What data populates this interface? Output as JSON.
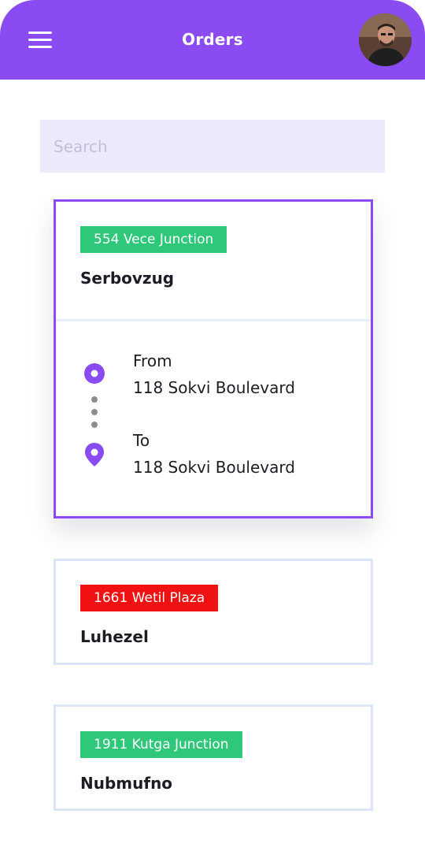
{
  "header": {
    "title": "Orders",
    "avatar_alt": "User avatar",
    "accent_color": "#8a4bf2"
  },
  "search": {
    "placeholder": "Search",
    "value": ""
  },
  "orders": [
    {
      "badge": "554 Vece Junction",
      "badge_color": "#2fc779",
      "name": "Serbovzug",
      "from_label": "From",
      "from_address": "118 Sokvi Boulevard",
      "to_label": "To",
      "to_address": "118 Sokvi Boulevard"
    },
    {
      "badge": "1661 Wetil Plaza",
      "badge_color": "#f01212",
      "name": "Luhezel"
    },
    {
      "badge": "1911 Kutga Junction",
      "badge_color": "#2fc779",
      "name": "Nubmufno"
    }
  ],
  "icons": {
    "menu": "hamburger-menu-icon",
    "origin": "origin-circle-icon",
    "destination": "location-pin-icon"
  }
}
